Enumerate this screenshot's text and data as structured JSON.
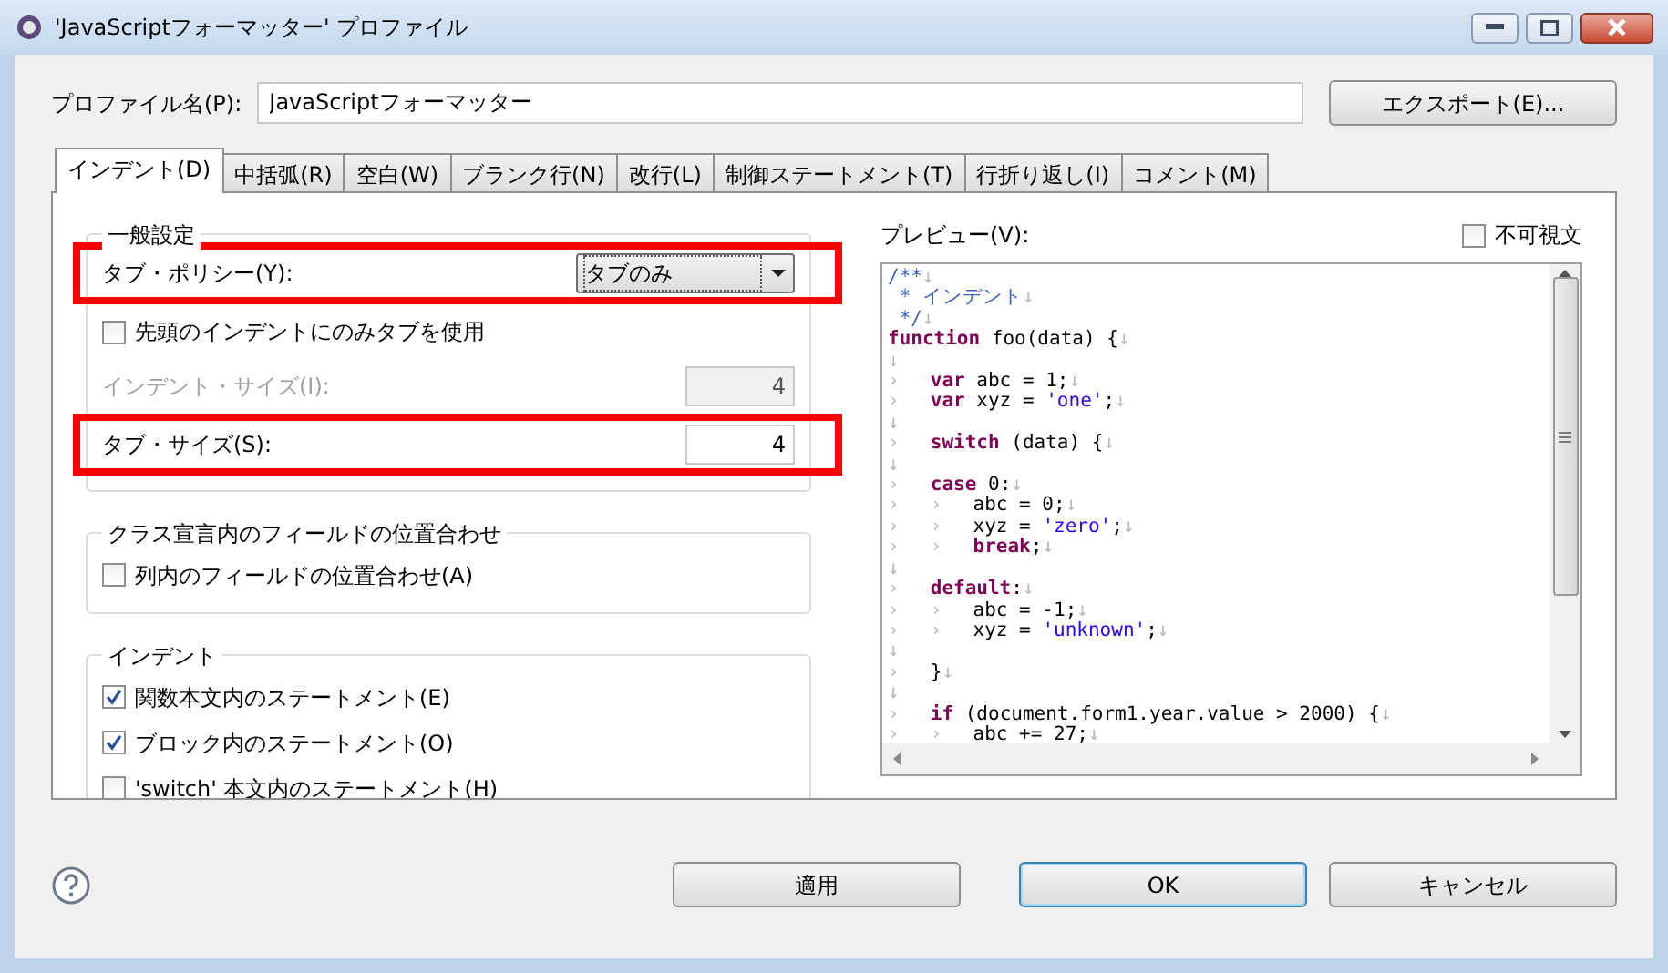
{
  "window": {
    "title": "'JavaScriptフォーマッター' プロファイル"
  },
  "profile": {
    "label": "プロファイル名(P):",
    "value": "JavaScriptフォーマッター",
    "export_button": "エクスポート(E)..."
  },
  "tabs": [
    {
      "label": "インデント(D)",
      "selected": true
    },
    {
      "label": "中括弧(R)",
      "selected": false
    },
    {
      "label": "空白(W)",
      "selected": false
    },
    {
      "label": "ブランク行(N)",
      "selected": false
    },
    {
      "label": "改行(L)",
      "selected": false
    },
    {
      "label": "制御ステートメント(T)",
      "selected": false
    },
    {
      "label": "行折り返し(I)",
      "selected": false
    },
    {
      "label": "コメント(M)",
      "selected": false
    }
  ],
  "general": {
    "title": "一般設定",
    "rows": [
      {
        "kind": "select",
        "label": "タブ・ポリシー(Y):",
        "value": "タブのみ",
        "highlighted": true
      },
      {
        "kind": "checkbox",
        "label": "先頭のインデントにのみタブを使用",
        "checked": false,
        "highlighted": false
      },
      {
        "kind": "number",
        "label": "インデント・サイズ(I):",
        "value": "4",
        "disabled": true,
        "highlighted": false
      },
      {
        "kind": "number",
        "label": "タブ・サイズ(S):",
        "value": "4",
        "disabled": false,
        "highlighted": true
      }
    ]
  },
  "field_alignment": {
    "title": "クラス宣言内のフィールドの位置合わせ",
    "items": [
      {
        "label": "列内のフィールドの位置合わせ(A)",
        "checked": false
      }
    ]
  },
  "indent": {
    "title": "インデント",
    "items": [
      {
        "label": "関数本文内のステートメント(E)",
        "checked": true
      },
      {
        "label": "ブロック内のステートメント(O)",
        "checked": true
      },
      {
        "label": "'switch' 本文内のステートメント(H)",
        "checked": false
      }
    ]
  },
  "preview": {
    "label": "プレビュー(V):",
    "invisible_checkbox": {
      "label": "不可視文",
      "checked": false
    },
    "lines": [
      [
        {
          "kind": "comment",
          "text": "/**"
        },
        {
          "kind": "eol",
          "text": "↓"
        }
      ],
      [
        {
          "kind": "comment",
          "text": " * インデント"
        },
        {
          "kind": "eol",
          "text": "↓"
        }
      ],
      [
        {
          "kind": "comment",
          "text": " */"
        },
        {
          "kind": "eol",
          "text": "↓"
        }
      ],
      [
        {
          "kind": "keyword",
          "text": "function"
        },
        {
          "kind": "code",
          "text": " foo(data) {"
        },
        {
          "kind": "eol",
          "text": "↓"
        }
      ],
      [
        {
          "kind": "eol",
          "text": "↓"
        }
      ],
      [
        {
          "kind": "tab",
          "text": "›"
        },
        {
          "kind": "keyword",
          "text": "var"
        },
        {
          "kind": "code",
          "text": " abc = 1;"
        },
        {
          "kind": "eol",
          "text": "↓"
        }
      ],
      [
        {
          "kind": "tab",
          "text": "›"
        },
        {
          "kind": "keyword",
          "text": "var"
        },
        {
          "kind": "code",
          "text": " xyz = "
        },
        {
          "kind": "string",
          "text": "'one'"
        },
        {
          "kind": "code",
          "text": ";"
        },
        {
          "kind": "eol",
          "text": "↓"
        }
      ],
      [
        {
          "kind": "eol",
          "text": "↓"
        }
      ],
      [
        {
          "kind": "tab",
          "text": "›"
        },
        {
          "kind": "keyword",
          "text": "switch"
        },
        {
          "kind": "code",
          "text": " (data) {"
        },
        {
          "kind": "eol",
          "text": "↓"
        }
      ],
      [
        {
          "kind": "eol",
          "text": "↓"
        }
      ],
      [
        {
          "kind": "tab",
          "text": "›"
        },
        {
          "kind": "keyword",
          "text": "case"
        },
        {
          "kind": "code",
          "text": " 0:"
        },
        {
          "kind": "eol",
          "text": "↓"
        }
      ],
      [
        {
          "kind": "tab",
          "text": "›"
        },
        {
          "kind": "tab",
          "text": "›"
        },
        {
          "kind": "code",
          "text": "abc = 0;"
        },
        {
          "kind": "eol",
          "text": "↓"
        }
      ],
      [
        {
          "kind": "tab",
          "text": "›"
        },
        {
          "kind": "tab",
          "text": "›"
        },
        {
          "kind": "code",
          "text": "xyz = "
        },
        {
          "kind": "string",
          "text": "'zero'"
        },
        {
          "kind": "code",
          "text": ";"
        },
        {
          "kind": "eol",
          "text": "↓"
        }
      ],
      [
        {
          "kind": "tab",
          "text": "›"
        },
        {
          "kind": "tab",
          "text": "›"
        },
        {
          "kind": "keyword",
          "text": "break"
        },
        {
          "kind": "code",
          "text": ";"
        },
        {
          "kind": "eol",
          "text": "↓"
        }
      ],
      [
        {
          "kind": "eol",
          "text": "↓"
        }
      ],
      [
        {
          "kind": "tab",
          "text": "›"
        },
        {
          "kind": "keyword",
          "text": "default"
        },
        {
          "kind": "code",
          "text": ":"
        },
        {
          "kind": "eol",
          "text": "↓"
        }
      ],
      [
        {
          "kind": "tab",
          "text": "›"
        },
        {
          "kind": "tab",
          "text": "›"
        },
        {
          "kind": "code",
          "text": "abc = -1;"
        },
        {
          "kind": "eol",
          "text": "↓"
        }
      ],
      [
        {
          "kind": "tab",
          "text": "›"
        },
        {
          "kind": "tab",
          "text": "›"
        },
        {
          "kind": "code",
          "text": "xyz = "
        },
        {
          "kind": "string",
          "text": "'unknown'"
        },
        {
          "kind": "code",
          "text": ";"
        },
        {
          "kind": "eol",
          "text": "↓"
        }
      ],
      [
        {
          "kind": "eol",
          "text": "↓"
        }
      ],
      [
        {
          "kind": "tab",
          "text": "›"
        },
        {
          "kind": "code",
          "text": "}"
        },
        {
          "kind": "eol",
          "text": "↓"
        }
      ],
      [
        {
          "kind": "eol",
          "text": "↓"
        }
      ],
      [
        {
          "kind": "tab",
          "text": "›"
        },
        {
          "kind": "keyword",
          "text": "if"
        },
        {
          "kind": "code",
          "text": " (document.form1.year.value > 2000) {"
        },
        {
          "kind": "eol",
          "text": "↓"
        }
      ],
      [
        {
          "kind": "tab",
          "text": "›"
        },
        {
          "kind": "tab",
          "text": "›"
        },
        {
          "kind": "code",
          "text": "abc += 27;"
        },
        {
          "kind": "eol",
          "text": "↓"
        }
      ]
    ]
  },
  "buttons": [
    {
      "label": "適用",
      "default": false
    },
    {
      "label": "OK",
      "default": true
    },
    {
      "label": "キャンセル",
      "default": false
    }
  ]
}
